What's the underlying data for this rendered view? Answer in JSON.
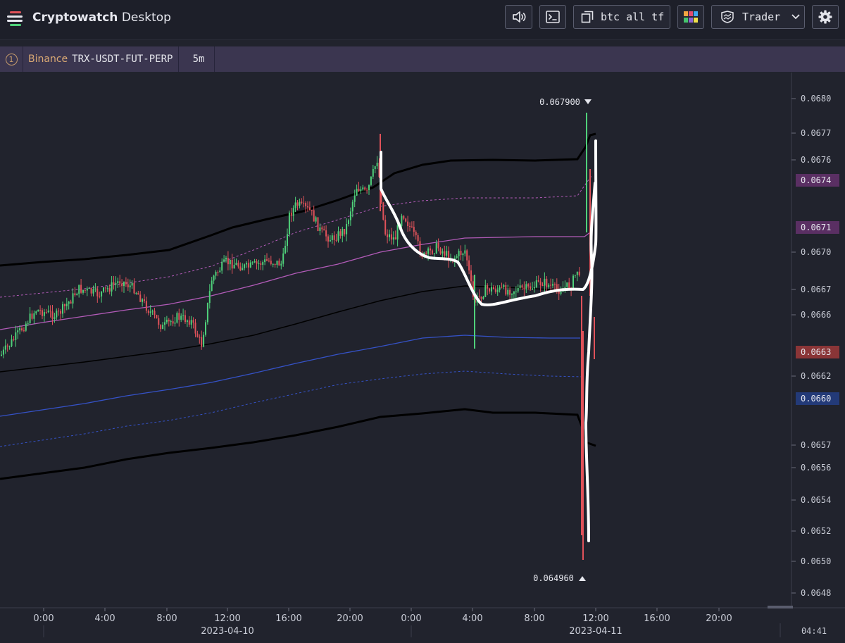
{
  "app": {
    "title_bold": "Cryptowatch",
    "title_light": "Desktop"
  },
  "toolbar": {
    "sound_icon": "speaker-icon",
    "terminal_icon": "terminal-icon",
    "layout_label": "btc all tf",
    "layout_icon": "popout-icon",
    "colors_icon": "color-palette-icon",
    "workspace_label": "Trader",
    "settings_icon": "gear-icon"
  },
  "market_tab": {
    "number": "1",
    "exchange": "Binance",
    "pair": "TRX-USDT-FUT-PERP",
    "timeframe": "5m"
  },
  "time_axis": {
    "ticks": [
      "0:00",
      "4:00",
      "8:00",
      "12:00",
      "16:00",
      "20:00",
      "0:00",
      "4:00",
      "8:00",
      "12:00",
      "16:00",
      "20:00"
    ],
    "dates": [
      "2023-04-10",
      "2023-04-11"
    ],
    "clock": "04:41"
  },
  "price_axis": {
    "ticks": [
      "0.0680",
      "0.0677",
      "0.0676",
      "0.0670",
      "0.0667",
      "0.0666",
      "0.0662",
      "0.0657",
      "0.0656",
      "0.0654",
      "0.0652",
      "0.0650",
      "0.0648"
    ],
    "highlighted": [
      {
        "label": "0.0674",
        "color": "#5a2f63"
      },
      {
        "label": "0.0671",
        "color": "#5a2f63"
      },
      {
        "label": "0.0663",
        "color": "#8a3537"
      },
      {
        "label": "0.0660",
        "color": "#233a78"
      }
    ]
  },
  "annotations": {
    "high": "0.067900",
    "low": "0.064960"
  },
  "colors": {
    "up": "#4fd17a",
    "down": "#e0525a",
    "background": "#21232d",
    "titlebar": "#1d1f29",
    "tabbar": "#3b3650",
    "accent": "#d9a874"
  }
}
